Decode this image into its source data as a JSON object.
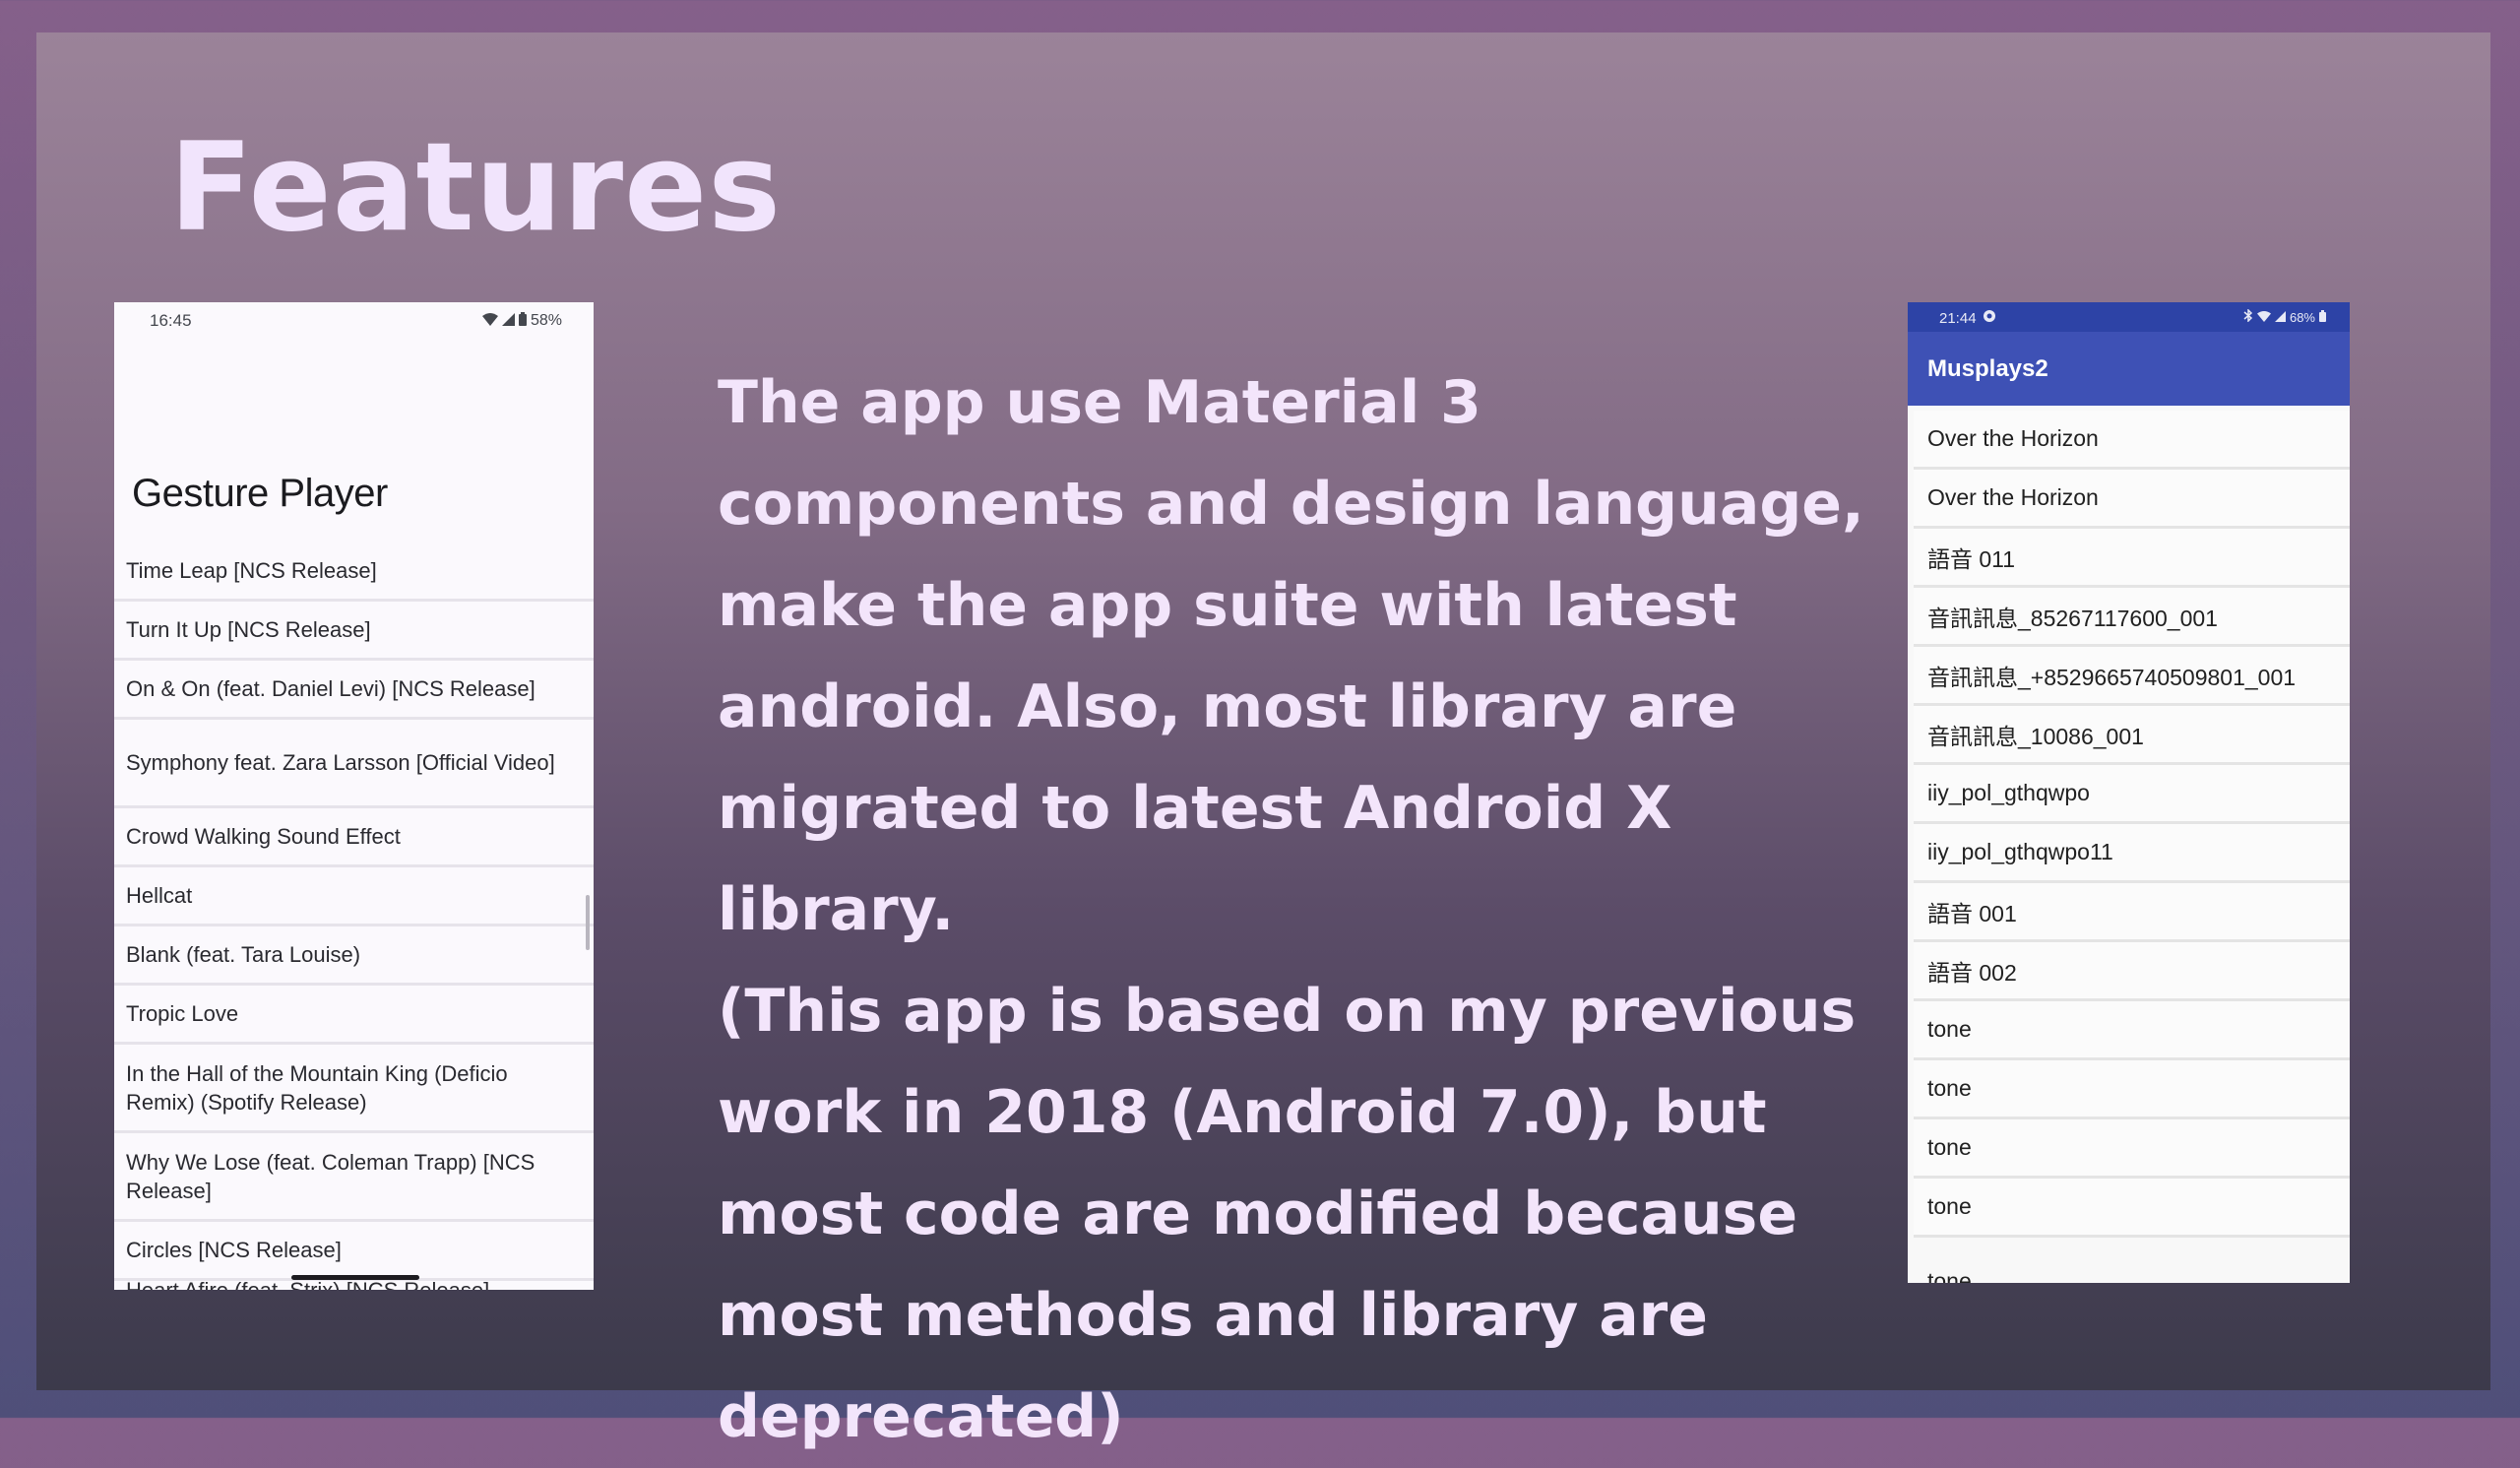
{
  "slide": {
    "title": "Features",
    "body_paragraphs": [
      "The app use Material 3 components and design language, make the app suite with latest android. Also, most library are migrated to latest Android X library.",
      "(This app is based on my previous work in 2018 (Android 7.0), but most code are modified because most methods and library are deprecated)"
    ]
  },
  "phone_left": {
    "status_time": "16:45",
    "status_battery": "58%",
    "app_title": "Gesture Player",
    "songs": [
      "Time Leap [NCS Release]",
      "Turn It Up [NCS Release]",
      "On & On (feat. Daniel Levi) [NCS Release]",
      "Symphony feat. Zara Larsson [Official Video]",
      "Crowd Walking Sound Effect",
      "Hellcat",
      "Blank (feat. Tara Louise)",
      "Tropic Love",
      "In the Hall of the Mountain King (Deficio Remix) (Spotify Release)",
      "Why We Lose (feat. Coleman Trapp) [NCS Release]",
      "Circles [NCS Release]"
    ],
    "partial_item": "Heart Afire (feat. Strix) [NCS Release]"
  },
  "phone_right": {
    "status_time": "21:44",
    "status_battery": "68%",
    "app_title": "Musplays2",
    "items": [
      "Over the Horizon",
      "Over the Horizon",
      "語音 011",
      "音訊訊息_85267117600_001",
      "音訊訊息_+8529665740509801_001",
      "音訊訊息_10086_001",
      "iiy_pol_gthqwpo",
      "iiy_pol_gthqwpo11",
      "語音 001",
      "語音 002",
      "tone",
      "tone",
      "tone",
      "tone"
    ],
    "partial_item": "tone"
  },
  "colors": {
    "title": "#f1e4fc",
    "body_text": "#f3e5fb",
    "right_app_bar": "#3e51b5",
    "right_status_bar": "#2d43a6"
  }
}
